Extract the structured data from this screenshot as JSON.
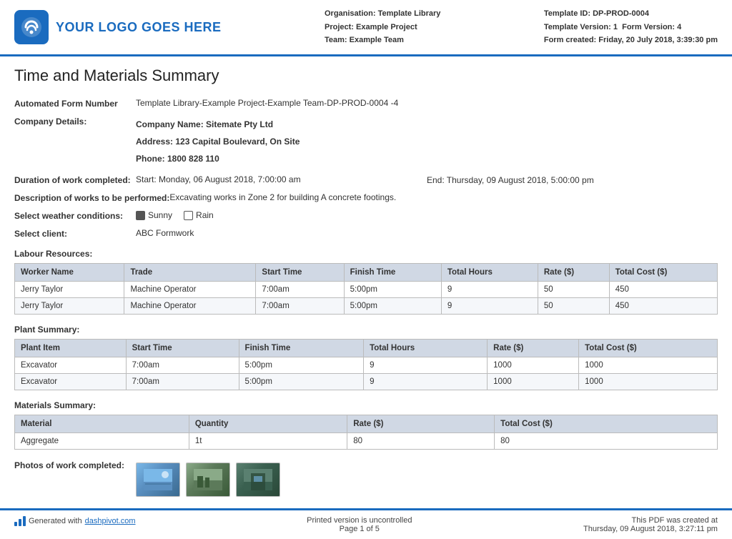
{
  "header": {
    "logo_text": "YOUR LOGO GOES HERE",
    "organisation_label": "Organisation:",
    "organisation_value": "Template Library",
    "project_label": "Project:",
    "project_value": "Example Project",
    "team_label": "Team:",
    "team_value": "Example Team",
    "template_id_label": "Template ID:",
    "template_id_value": "DP-PROD-0004",
    "template_version_label": "Template Version:",
    "template_version_value": "1",
    "form_version_label": "Form Version:",
    "form_version_value": "4",
    "form_created_label": "Form created:",
    "form_created_value": "Friday, 20 July 2018, 3:39:30 pm"
  },
  "page_title": "Time and Materials Summary",
  "form": {
    "automated_form_label": "Automated Form Number",
    "automated_form_value": "Template Library-Example Project-Example Team-DP-PROD-0004   -4",
    "company_details_label": "Company Details:",
    "company_name": "Company Name: Sitemate Pty Ltd",
    "company_address": "Address: 123 Capital Boulevard, On Site",
    "company_phone": "Phone: 1800 828 110",
    "duration_label": "Duration of work completed:",
    "duration_start": "Start: Monday, 06 August 2018, 7:00:00 am",
    "duration_end": "End: Thursday, 09 August 2018, 5:00:00 pm",
    "description_label": "Description of works to be performed:",
    "description_value": "Excavating works in Zone 2 for building A concrete footings.",
    "weather_label": "Select weather conditions:",
    "weather_options": [
      {
        "label": "Sunny",
        "checked": true
      },
      {
        "label": "Rain",
        "checked": false
      }
    ],
    "client_label": "Select client:",
    "client_value": "ABC Formwork"
  },
  "labour_section": {
    "title": "Labour Resources:",
    "headers": [
      "Worker Name",
      "Trade",
      "Start Time",
      "Finish Time",
      "Total Hours",
      "Rate ($)",
      "Total Cost ($)"
    ],
    "rows": [
      [
        "Jerry Taylor",
        "Machine Operator",
        "7:00am",
        "5:00pm",
        "9",
        "50",
        "450"
      ],
      [
        "Jerry Taylor",
        "Machine Operator",
        "7:00am",
        "5:00pm",
        "9",
        "50",
        "450"
      ]
    ]
  },
  "plant_section": {
    "title": "Plant Summary:",
    "headers": [
      "Plant Item",
      "Start Time",
      "Finish Time",
      "Total Hours",
      "Rate ($)",
      "Total Cost ($)"
    ],
    "rows": [
      [
        "Excavator",
        "7:00am",
        "5:00pm",
        "9",
        "1000",
        "1000"
      ],
      [
        "Excavator",
        "7:00am",
        "5:00pm",
        "9",
        "1000",
        "1000"
      ]
    ]
  },
  "materials_section": {
    "title": "Materials Summary:",
    "headers": [
      "Material",
      "Quantity",
      "Rate ($)",
      "Total Cost ($)"
    ],
    "rows": [
      [
        "Aggregate",
        "1t",
        "80",
        "80"
      ]
    ]
  },
  "photos_section": {
    "label": "Photos of work completed:",
    "count": 3
  },
  "footer": {
    "generated_text": "Generated with ",
    "link_text": "dashpivot.com",
    "center_line1": "Printed version is uncontrolled",
    "center_line2": "Page 1 of 5",
    "right_line1": "This PDF was created at",
    "right_line2": "Thursday, 09 August 2018, 3:27:11 pm"
  }
}
